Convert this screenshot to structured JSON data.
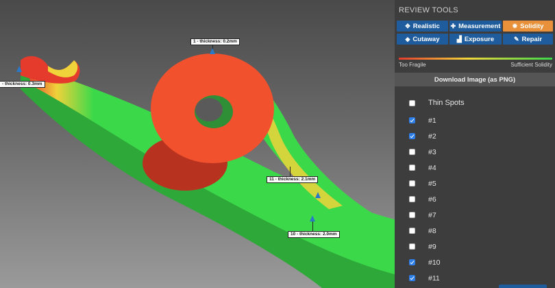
{
  "viewport": {
    "annotations": [
      {
        "id": "1",
        "label": "1 - thickness: 0.2mm"
      },
      {
        "id": "left",
        "label": "- thickness: 0.3mm"
      },
      {
        "id": "11",
        "label": "11 - thickness: 2.1mm"
      },
      {
        "id": "10",
        "label": "10 - thickness: 2.0mm"
      }
    ]
  },
  "panel": {
    "title": "REVIEW TOOLS",
    "tools": [
      {
        "label": "Realistic",
        "icon": "crosshair-icon",
        "active": false
      },
      {
        "label": "Measurement",
        "icon": "move-icon",
        "active": false
      },
      {
        "label": "Solidity",
        "icon": "gear-icon",
        "active": true
      },
      {
        "label": "Cutaway",
        "icon": "cube-icon",
        "active": false
      },
      {
        "label": "Exposure",
        "icon": "chart-icon",
        "active": false
      },
      {
        "label": "Repair",
        "icon": "wrench-icon",
        "active": false
      }
    ],
    "scale": {
      "left": "Too Fragile",
      "right": "Sufficient Solidity"
    },
    "download_label": "Download Image (as PNG)",
    "list_header": "Thin Spots",
    "spots": [
      {
        "label": "#1",
        "checked": true
      },
      {
        "label": "#2",
        "checked": true
      },
      {
        "label": "#3",
        "checked": false
      },
      {
        "label": "#4",
        "checked": false
      },
      {
        "label": "#5",
        "checked": false
      },
      {
        "label": "#6",
        "checked": false
      },
      {
        "label": "#7",
        "checked": false
      },
      {
        "label": "#8",
        "checked": false
      },
      {
        "label": "#9",
        "checked": false
      },
      {
        "label": "#10",
        "checked": true
      },
      {
        "label": "#11",
        "checked": true
      }
    ]
  },
  "colors": {
    "fragile": "#e53b2c",
    "solid": "#3bd94a",
    "accent": "#1e5c9e",
    "active": "#e8913a"
  }
}
